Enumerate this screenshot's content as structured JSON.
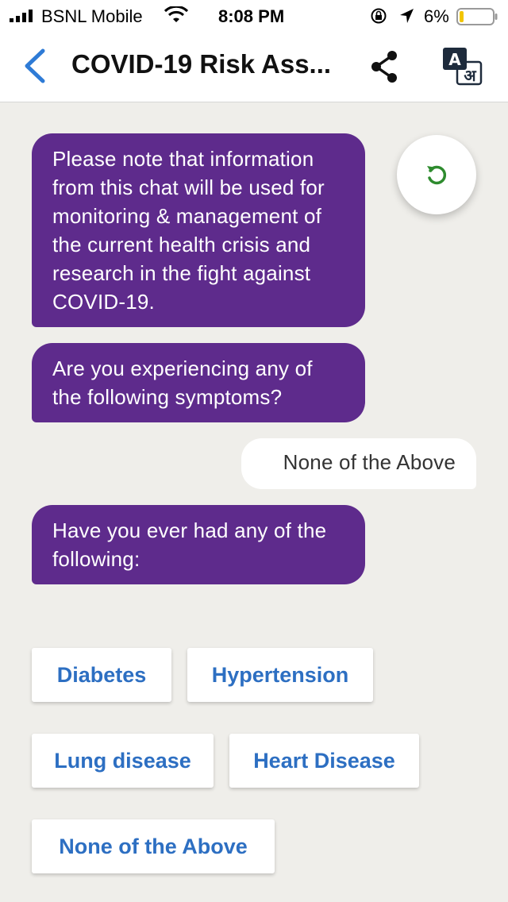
{
  "status_bar": {
    "carrier": "BSNL Mobile",
    "time": "8:08 PM",
    "battery_pct": "6%",
    "icons": [
      "signal-icon",
      "wifi-icon",
      "orientation-lock-icon",
      "location-icon",
      "battery-icon"
    ]
  },
  "nav": {
    "title": "COVID-19 Risk Ass...",
    "translate_latin": "A",
    "translate_devanagari": "अ",
    "icons": [
      "back-chevron-icon",
      "share-icon",
      "translate-icon"
    ]
  },
  "chat": {
    "messages": [
      {
        "sender": "bot",
        "text": "Please note that information from this chat will be used for monitoring & management of the current health crisis and research in the fight against COVID-19."
      },
      {
        "sender": "bot",
        "text": "Are you experiencing any of the following symptoms?"
      },
      {
        "sender": "user",
        "text": "None of the Above"
      },
      {
        "sender": "bot",
        "text": "Have you ever had any of the following:"
      }
    ],
    "options": [
      "Diabetes",
      "Hypertension",
      "Lung disease",
      "Heart Disease",
      "None of the Above"
    ]
  },
  "colors": {
    "bot_bubble": "#5e2b8c",
    "option_text": "#2d6fc2",
    "back_accent": "#2e7bd6",
    "refresh_icon": "#2e8b2e",
    "background": "#efeeea"
  }
}
